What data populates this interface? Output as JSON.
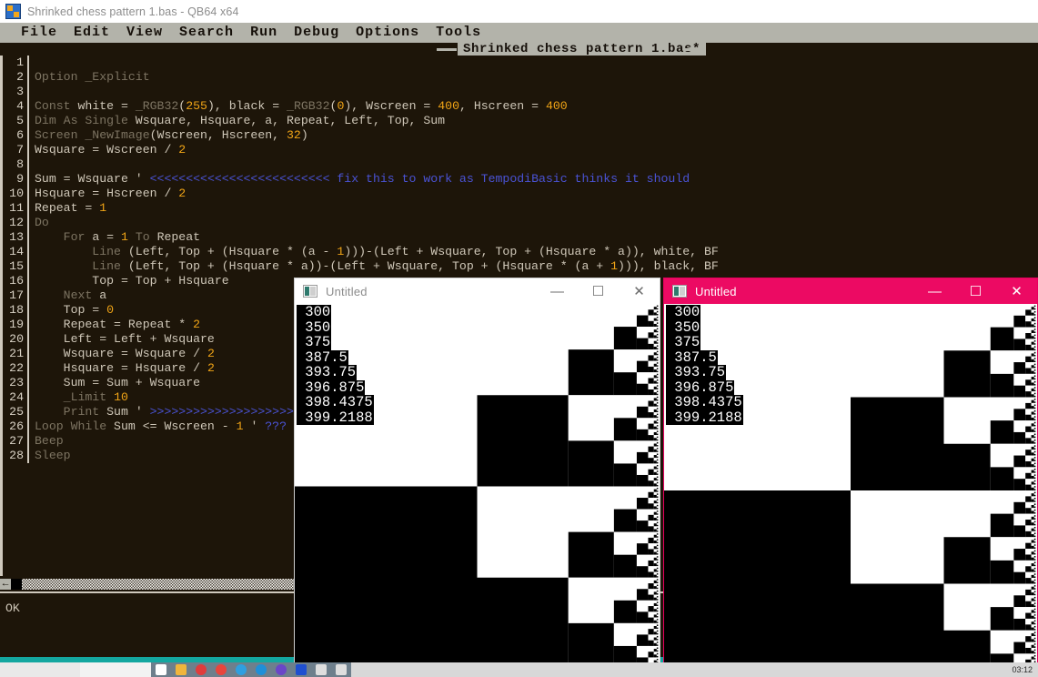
{
  "window": {
    "app_icon": "qb64-logo-icon",
    "title": "Shrinked chess pattern 1.bas - QB64 x64"
  },
  "menubar": {
    "items": [
      "File",
      "Edit",
      "View",
      "Search",
      "Run",
      "Debug",
      "Options",
      "Tools"
    ]
  },
  "tab": {
    "label": "Shrinked chess pattern 1.bas*"
  },
  "editor": {
    "lines": [
      {
        "n": "1",
        "tokens": []
      },
      {
        "n": "2",
        "tokens": [
          {
            "t": "Option _Explicit",
            "c": "c-kw"
          }
        ]
      },
      {
        "n": "3",
        "tokens": []
      },
      {
        "n": "4",
        "tokens": [
          {
            "t": "Const",
            "c": "c-kw"
          },
          {
            "t": " white = ",
            "c": "c-id"
          },
          {
            "t": "_RGB32",
            "c": "c-kw"
          },
          {
            "t": "(",
            "c": "c-id"
          },
          {
            "t": "255",
            "c": "c-num"
          },
          {
            "t": "), black = ",
            "c": "c-id"
          },
          {
            "t": "_RGB32",
            "c": "c-kw"
          },
          {
            "t": "(",
            "c": "c-id"
          },
          {
            "t": "0",
            "c": "c-num"
          },
          {
            "t": "), Wscreen = ",
            "c": "c-id"
          },
          {
            "t": "400",
            "c": "c-num"
          },
          {
            "t": ", Hscreen = ",
            "c": "c-id"
          },
          {
            "t": "400",
            "c": "c-num"
          }
        ]
      },
      {
        "n": "5",
        "tokens": [
          {
            "t": "Dim As Single",
            "c": "c-kw"
          },
          {
            "t": " Wsquare, Hsquare, a, Repeat, Left, Top, Sum",
            "c": "c-id"
          }
        ]
      },
      {
        "n": "6",
        "tokens": [
          {
            "t": "Screen _NewImage",
            "c": "c-kw"
          },
          {
            "t": "(Wscreen, Hscreen, ",
            "c": "c-id"
          },
          {
            "t": "32",
            "c": "c-num"
          },
          {
            "t": ")",
            "c": "c-id"
          }
        ]
      },
      {
        "n": "7",
        "tokens": [
          {
            "t": "Wsquare = Wscreen / ",
            "c": "c-id"
          },
          {
            "t": "2",
            "c": "c-num"
          }
        ]
      },
      {
        "n": "8",
        "tokens": []
      },
      {
        "n": "9",
        "tokens": [
          {
            "t": "Sum = Wsquare ",
            "c": "c-id"
          },
          {
            "t": "'",
            "c": "c-comq"
          },
          {
            "t": " <<<<<<<<<<<<<<<<<<<<<<<<< fix this to work as TempodiBasic thinks it should",
            "c": "c-com"
          }
        ]
      },
      {
        "n": "10",
        "tokens": [
          {
            "t": "Hsquare = Hscreen / ",
            "c": "c-id"
          },
          {
            "t": "2",
            "c": "c-num"
          }
        ]
      },
      {
        "n": "11",
        "tokens": [
          {
            "t": "Repeat = ",
            "c": "c-id"
          },
          {
            "t": "1",
            "c": "c-num"
          }
        ]
      },
      {
        "n": "12",
        "tokens": [
          {
            "t": "Do",
            "c": "c-kw"
          }
        ]
      },
      {
        "n": "13",
        "tokens": [
          {
            "t": "    For",
            "c": "c-kw"
          },
          {
            "t": " a = ",
            "c": "c-id"
          },
          {
            "t": "1",
            "c": "c-num"
          },
          {
            "t": " ",
            "c": "c-id"
          },
          {
            "t": "To",
            "c": "c-kw"
          },
          {
            "t": " Repeat",
            "c": "c-id"
          }
        ]
      },
      {
        "n": "14",
        "tokens": [
          {
            "t": "        Line",
            "c": "c-kw"
          },
          {
            "t": " (Left, Top + (Hsquare * (a - ",
            "c": "c-id"
          },
          {
            "t": "1",
            "c": "c-num"
          },
          {
            "t": ")))-(Left + Wsquare, Top + (Hsquare * a)), white, BF",
            "c": "c-id"
          }
        ]
      },
      {
        "n": "15",
        "tokens": [
          {
            "t": "        Line",
            "c": "c-kw"
          },
          {
            "t": " (Left, Top + (Hsquare * a))-(Left + Wsquare, Top + (Hsquare * (a + ",
            "c": "c-id"
          },
          {
            "t": "1",
            "c": "c-num"
          },
          {
            "t": "))), black, BF",
            "c": "c-id"
          }
        ]
      },
      {
        "n": "16",
        "tokens": [
          {
            "t": "        Top = Top + Hsquare",
            "c": "c-id"
          }
        ]
      },
      {
        "n": "17",
        "tokens": [
          {
            "t": "    Next",
            "c": "c-kw"
          },
          {
            "t": " a",
            "c": "c-id"
          }
        ]
      },
      {
        "n": "18",
        "tokens": [
          {
            "t": "    Top = ",
            "c": "c-id"
          },
          {
            "t": "0",
            "c": "c-num"
          }
        ]
      },
      {
        "n": "19",
        "tokens": [
          {
            "t": "    Repeat = Repeat * ",
            "c": "c-id"
          },
          {
            "t": "2",
            "c": "c-num"
          }
        ]
      },
      {
        "n": "20",
        "tokens": [
          {
            "t": "    Left = Left + Wsquare",
            "c": "c-id"
          }
        ]
      },
      {
        "n": "21",
        "tokens": [
          {
            "t": "    Wsquare = Wsquare / ",
            "c": "c-id"
          },
          {
            "t": "2",
            "c": "c-num"
          }
        ]
      },
      {
        "n": "22",
        "tokens": [
          {
            "t": "    Hsquare = Hsquare / ",
            "c": "c-id"
          },
          {
            "t": "2",
            "c": "c-num"
          }
        ]
      },
      {
        "n": "23",
        "tokens": [
          {
            "t": "    Sum = Sum + Wsquare",
            "c": "c-id"
          }
        ]
      },
      {
        "n": "24",
        "tokens": [
          {
            "t": "    _Limit",
            "c": "c-kw"
          },
          {
            "t": " ",
            "c": "c-id"
          },
          {
            "t": "10",
            "c": "c-num"
          }
        ]
      },
      {
        "n": "25",
        "tokens": [
          {
            "t": "    Print",
            "c": "c-kw"
          },
          {
            "t": " Sum ",
            "c": "c-id"
          },
          {
            "t": "'",
            "c": "c-comq"
          },
          {
            "t": " >>>>>>>>>>>>>>>>>>>>>",
            "c": "c-com"
          }
        ]
      },
      {
        "n": "26",
        "tokens": [
          {
            "t": "Loop While",
            "c": "c-kw"
          },
          {
            "t": " Sum <= Wscreen - ",
            "c": "c-id"
          },
          {
            "t": "1",
            "c": "c-num"
          },
          {
            "t": " ",
            "c": "c-id"
          },
          {
            "t": "'",
            "c": "c-comq"
          },
          {
            "t": " ???",
            "c": "c-com"
          }
        ]
      },
      {
        "n": "27",
        "tokens": [
          {
            "t": "Beep",
            "c": "c-kw"
          }
        ]
      },
      {
        "n": "28",
        "tokens": [
          {
            "t": "Sleep",
            "c": "c-kw"
          }
        ]
      }
    ]
  },
  "scrollbar": {
    "left_arrow": "←"
  },
  "immediate": {
    "text": "OK"
  },
  "output_window_1": {
    "icon": "program-window-icon",
    "title": "Untitled",
    "minimize": "—",
    "maximize": "☐",
    "close": "✕",
    "print_values": [
      "300",
      "350",
      "375",
      "387.5",
      "393.75",
      "396.875",
      "398.4375",
      "399.2188"
    ],
    "titlebar_color": "#ffffff",
    "state": "inactive"
  },
  "output_window_2": {
    "icon": "program-window-icon",
    "title": "Untitled",
    "minimize": "—",
    "maximize": "☐",
    "close": "✕",
    "print_values": [
      "300",
      "350",
      "375",
      "387.5",
      "393.75",
      "396.875",
      "398.4375",
      "399.2188"
    ],
    "titlebar_color": "#ec0a63",
    "state": "active"
  },
  "taskbar": {
    "clock": "03:12",
    "icons": [
      {
        "name": "start-icon",
        "color": "#ffffff"
      },
      {
        "name": "file-explorer-icon",
        "color": "#f0b53c"
      },
      {
        "name": "compass-icon",
        "color": "#e03c3c"
      },
      {
        "name": "chrome-icon",
        "color": "#e8453c"
      },
      {
        "name": "edge-legacy-icon",
        "color": "#2f9fe0"
      },
      {
        "name": "edge-icon",
        "color": "#1f8fd8"
      },
      {
        "name": "firefox-icon",
        "color": "#6a46c8"
      },
      {
        "name": "qb64-icon",
        "color": "#1f4fd0"
      },
      {
        "name": "window-icon-1",
        "color": "#dedede"
      },
      {
        "name": "window-icon-2",
        "color": "#dedede"
      }
    ]
  },
  "colors": {
    "ide_background": "#1d1509",
    "menubar": "#b3b3aa",
    "accent_pink": "#ec0a63",
    "teal_band": "#14a7a0",
    "comment_blue": "#4a53d6",
    "number_orange": "#f0a416"
  }
}
